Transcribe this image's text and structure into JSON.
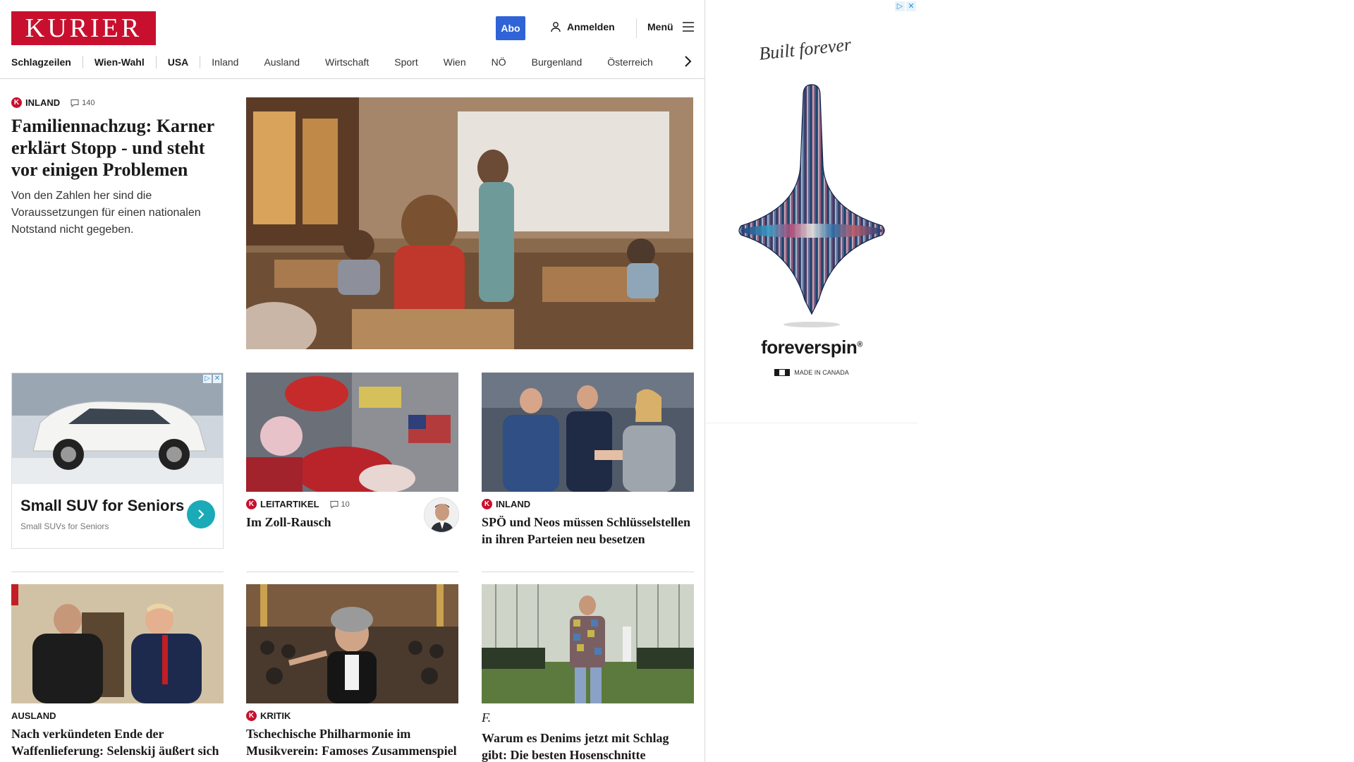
{
  "header": {
    "logo": "KURIER",
    "abo_label": "Abo",
    "login_label": "Anmelden",
    "menu_label": "Menü"
  },
  "nav": {
    "items": [
      "Schlagzeilen",
      "Wien-Wahl",
      "USA",
      "Inland",
      "Ausland",
      "Wirtschaft",
      "Sport",
      "Wien",
      "NÖ",
      "Burgenland",
      "Österreich"
    ]
  },
  "lead": {
    "category": "INLAND",
    "comments": "140",
    "headline": "Familiennachzug: Karner erklärt Stopp - und steht vor einigen Problemen",
    "teaser": "Von den Zahlen her sind die Voraussetzungen für einen nationalen Notstand nicht gegeben."
  },
  "ad_card": {
    "title": "Small SUV for Seniors",
    "subtitle": "Small SUVs for Seniors"
  },
  "cards": [
    {
      "category": "LEITARTIKEL",
      "comments": "10",
      "title": "Im Zoll-Rausch"
    },
    {
      "category": "INLAND",
      "title": "SPÖ und Neos müssen Schlüsselstellen in ihren Parteien neu besetzen"
    },
    {
      "category": "AUSLAND",
      "title": "Nach verkündeten Ende der Waffenlieferung: Selenskij äußert sich demütig"
    },
    {
      "category": "KRITIK",
      "title": "Tschechische Philharmonie im Musikverein: Famoses Zusammenspiel"
    },
    {
      "category": "f.",
      "title": "Warum es Denims jetzt mit Schlag gibt: Die besten Hosenschnitte"
    }
  ],
  "side_ad": {
    "script": "Built forever",
    "brand": "foreverspin",
    "made_in": "MADE IN CANADA"
  },
  "colors": {
    "brand_red": "#c8102e",
    "abo_blue": "#2f63d6",
    "ad_teal": "#1aaab8"
  }
}
